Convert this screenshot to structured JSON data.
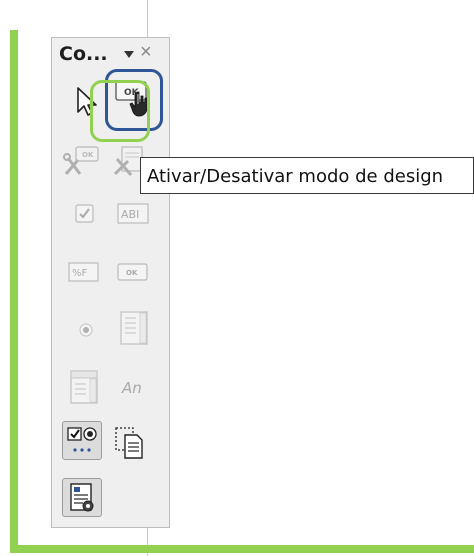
{
  "panel": {
    "title": "Co...",
    "tooltip": "Ativar/Desativar modo de design"
  },
  "tools": [
    {
      "name": "select",
      "icon": "pointer-icon",
      "enabled": true
    },
    {
      "name": "design-mode",
      "icon": "design-mode-icon",
      "enabled": true,
      "label": "OK"
    },
    {
      "name": "control-properties",
      "icon": "control-properties-icon",
      "enabled": false,
      "label": "OK"
    },
    {
      "name": "form-properties",
      "icon": "form-properties-icon",
      "enabled": false
    },
    {
      "name": "checkbox",
      "icon": "checkbox-icon",
      "enabled": false
    },
    {
      "name": "text-box",
      "icon": "text-box-icon",
      "enabled": false,
      "label": "ABI"
    },
    {
      "name": "formatted-field",
      "icon": "formatted-field-icon",
      "enabled": false,
      "label": "%F"
    },
    {
      "name": "push-button",
      "icon": "push-button-icon",
      "enabled": false,
      "label": "OK"
    },
    {
      "name": "option-button",
      "icon": "option-button-icon",
      "enabled": false
    },
    {
      "name": "list-box",
      "icon": "list-box-icon",
      "enabled": false
    },
    {
      "name": "combo-box",
      "icon": "combo-box-icon",
      "enabled": false
    },
    {
      "name": "label-field",
      "icon": "label-field-icon",
      "enabled": false,
      "label": "An"
    },
    {
      "name": "more-controls",
      "icon": "more-controls-icon",
      "enabled": true
    },
    {
      "name": "form-design",
      "icon": "form-design-icon",
      "enabled": true
    },
    {
      "name": "wizards",
      "icon": "wizards-icon",
      "enabled": true
    }
  ],
  "colors": {
    "frame": "#92d050",
    "highlight_blue": "#2f5597",
    "highlight_green": "#92d050"
  }
}
